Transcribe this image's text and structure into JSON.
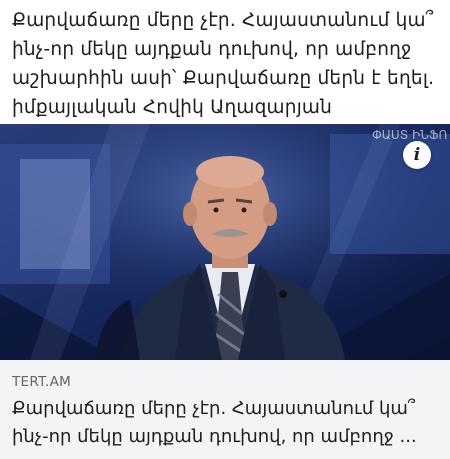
{
  "post": {
    "text": "Քարվաճառը մերը չէր. Հայաստանում կա՞\nինչ-որ մեկը այդքան դուխով, որ ամբողջ\nաշխարհին ասի՝ Քարվաճառը մերն է եղել.\nիմքայլական Հովիկ Աղազարյան"
  },
  "media": {
    "info_glyph": "i",
    "watermark": "ՓԱՍՏ ԻՆՖՈ",
    "info_icon": "info-icon"
  },
  "link": {
    "domain": "TERT.AM",
    "title": "Քարվաճառը մերը չէր. Հայաստանում կա՞\nինչ-որ մեկը այդքան դուխով, որ ամբողջ ..."
  },
  "colors": {
    "text": "#1c1e21",
    "muted": "#65676b",
    "card_bg": "#f3f4f6"
  }
}
